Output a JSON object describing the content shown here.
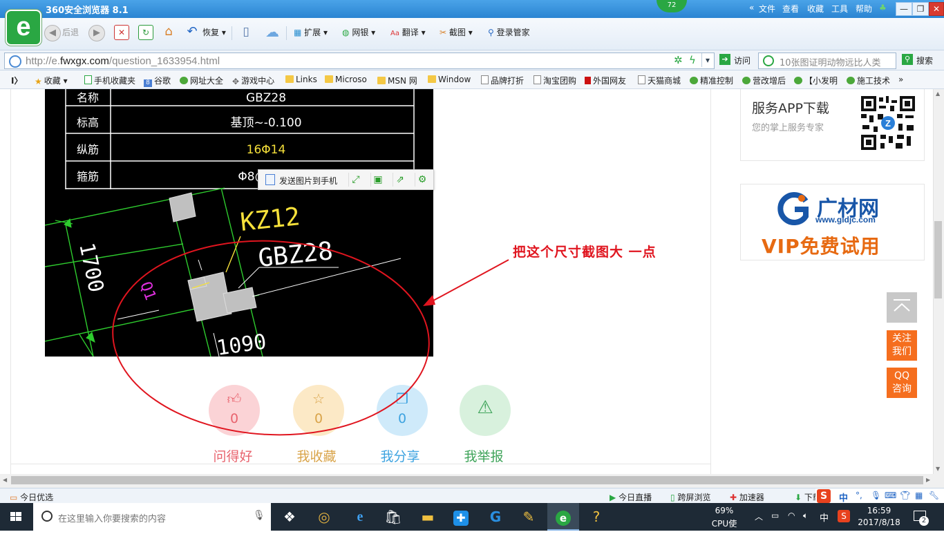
{
  "browser": {
    "title": "360安全浏览器 8.1",
    "badge": "72",
    "menu": [
      "文件",
      "查看",
      "收藏",
      "工具",
      "帮助"
    ],
    "toolbar": {
      "back": "后退",
      "restore": "恢复",
      "extend": "扩展",
      "bank": "网银",
      "translate": "翻译",
      "screenshot": "截图",
      "login": "登录管家"
    },
    "address": {
      "url_prefix": "http://e.",
      "url_domain": "fwxgx.com",
      "url_path": "/question_1633954.html",
      "visit": "访问",
      "search_placeholder": "10张图证明动物远比人类",
      "search_button": "搜索"
    },
    "bookmarks": [
      "收藏",
      "手机收藏夹",
      "谷歌",
      "网址大全",
      "游戏中心",
      "Links",
      "Microso",
      "MSN 网",
      "Window",
      "品牌打折",
      "淘宝团购",
      "外国网友",
      "天猫商城",
      "精准控制",
      "营改增后",
      "【小发明",
      "施工技术"
    ]
  },
  "cad_image": {
    "table_rows": [
      {
        "label": "名称",
        "value": "GBZ28"
      },
      {
        "label": "标高",
        "value": "基顶~-0.100"
      },
      {
        "label": "纵筋",
        "value": "16Φ14"
      },
      {
        "label": "箍筋",
        "value": "Φ8@"
      }
    ],
    "labels": {
      "kz": "KZ12",
      "gbz": "GBZ28",
      "dim1": "1700",
      "dim2": "1090",
      "mag": "Q1"
    }
  },
  "image_tools": {
    "send_to_phone": "发送图片到手机"
  },
  "annotation": "把这个尺寸截图大 一点",
  "colors": {
    "annotation_red": "#e0151f",
    "like": "#e8636e",
    "collect": "#d9a44a",
    "share": "#3ea3e0",
    "report": "#3fa45a"
  },
  "reactions": [
    {
      "name": "like",
      "icon": "thumbs-up-icon",
      "count": "0",
      "label": "问得好"
    },
    {
      "name": "collect",
      "icon": "star-icon",
      "count": "0",
      "label": "我收藏"
    },
    {
      "name": "share",
      "icon": "book-icon",
      "count": "0",
      "label": "我分享"
    },
    {
      "name": "report",
      "icon": "warning-icon",
      "count": "",
      "label": "我举报"
    }
  ],
  "sidebar": {
    "app_title": "服务APP下载",
    "app_subtitle": "您的掌上服务专家",
    "ad_brand": "广材网",
    "ad_url": "www.gldjc.com",
    "ad_slogan": "VIP免费试用",
    "follow": "关注我们",
    "qq": "QQ咨询"
  },
  "statusbar": {
    "today": "今日优选",
    "live": "今日直播",
    "cross_screen": "跨屏浏览",
    "accelerator": "加速器",
    "download": "下载",
    "ime": "中"
  },
  "taskbar": {
    "search_placeholder": "在这里输入你要搜索的内容",
    "cpu_percent": "69%",
    "cpu_label": "CPU使用",
    "ime": "中",
    "time": "16:59",
    "date": "2017/8/18",
    "notifications": "2"
  }
}
